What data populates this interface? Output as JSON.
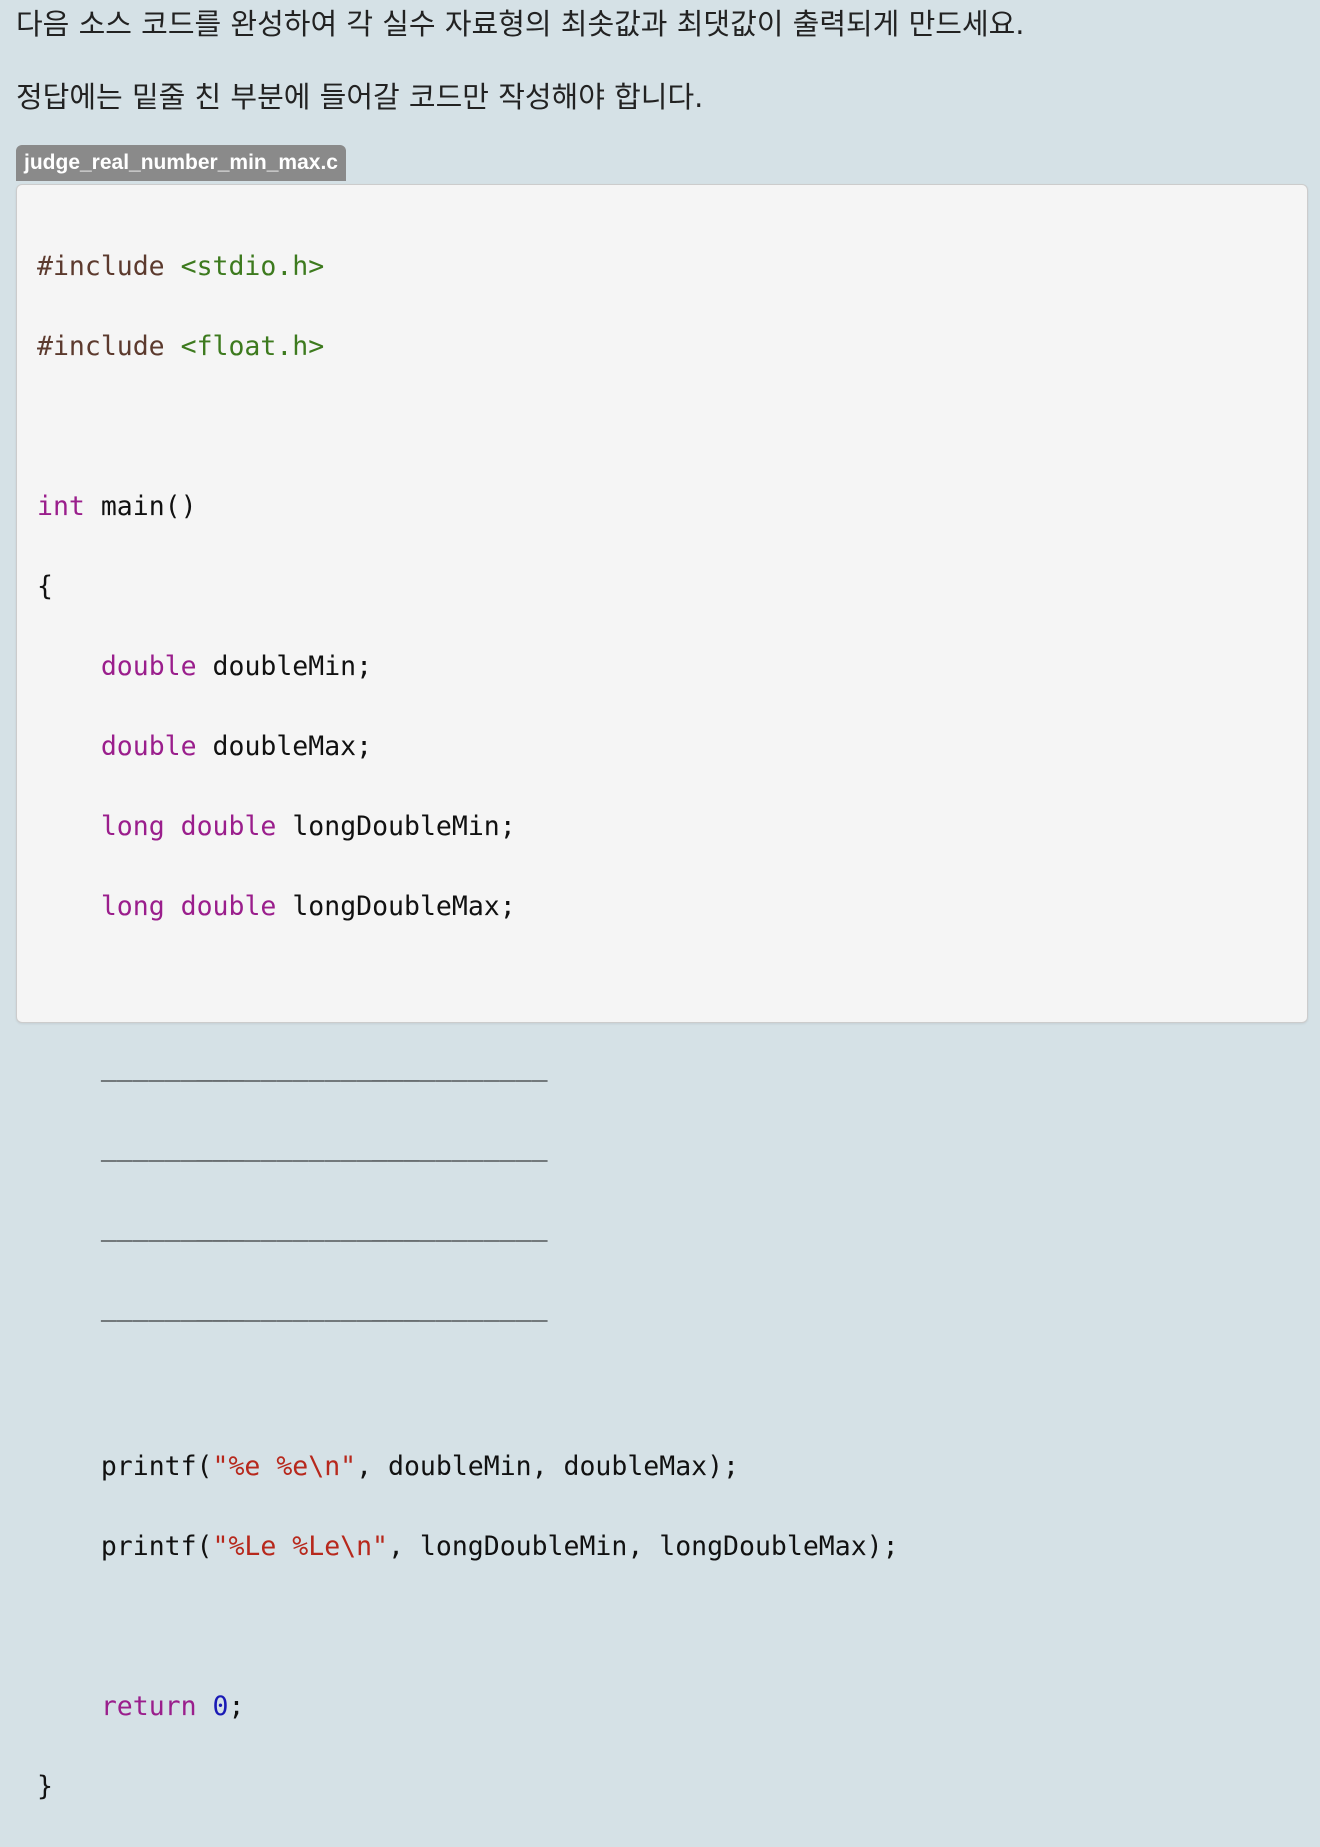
{
  "instructions": {
    "line1": "다음 소스 코드를 완성하여 각 실수 자료형의 최솟값과 최댓값이 출력되게 만드세요.",
    "line2": "정답에는 밑줄 친 부분에 들어갈 코드만 작성해야 합니다."
  },
  "file": {
    "name": "judge_real_number_min_max.c"
  },
  "code": {
    "include_kw": "#include",
    "include_stdio": "<stdio.h>",
    "include_float": "<float.h>",
    "int_kw": "int",
    "main_sig": "main()",
    "open_brace": "{",
    "close_brace": "}",
    "indent": "    ",
    "double_kw": "double",
    "long_kw": "long",
    "decl_double_min": "doubleMin;",
    "decl_double_max": "doubleMax;",
    "decl_long_double_min": "longDoubleMin;",
    "decl_long_double_max": "longDoubleMax;",
    "blank_line": "____________________________",
    "printf_kw": "printf(",
    "printf1_format": "\"%e %e\\n\"",
    "printf1_args": ", doubleMin, doubleMax);",
    "printf2_format": "\"%Le %Le\\n\"",
    "printf2_args": ", longDoubleMin, longDoubleMax);",
    "return_kw": "return",
    "return_value": "0",
    "semicolon": ";"
  },
  "colors": {
    "page_background": "#d5e1e6",
    "code_background": "#f5f5f5",
    "tab_background": "#8a8a8a",
    "preprocessor": "#5c3a2e",
    "header": "#3d7a1e",
    "keyword": "#9a1e8c",
    "string": "#b7281c",
    "number": "#1a1ab5"
  }
}
